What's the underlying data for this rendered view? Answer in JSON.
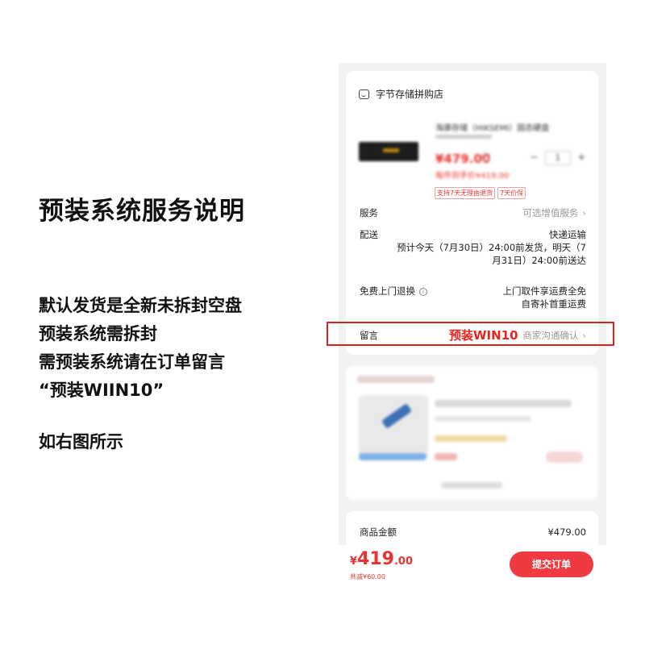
{
  "left": {
    "title": "预装系统服务说明",
    "notes": [
      "默认发货是全新未拆封空盘",
      "预装系统需拆封",
      "需预装系统请在订单留言",
      "“预装WIIN10”"
    ],
    "see_right": "如右图所示"
  },
  "order": {
    "shop_icon": "store-icon",
    "shop_name": "字节存储拼购店",
    "product": {
      "title": "海康存储（HIKSEMI）固态硬盘",
      "price": "¥479.00",
      "quantity": "1",
      "promo": "每件到手价¥419.00",
      "tags": [
        "支持7天无理由退货",
        "7天价保"
      ]
    },
    "service": {
      "label": "服务",
      "value": "可选增值服务"
    },
    "delivery": {
      "label": "配送",
      "method": "快递运输",
      "estimate_1": "预计今天（7月30日）24:00前发货，明天（7",
      "estimate_2": "月31日）24:00前送达"
    },
    "return": {
      "label": "免费上门退换",
      "value_1": "上门取件享运费全免",
      "value_2": "自寄补首重运费"
    },
    "message": {
      "label": "留言",
      "placeholder": "商家沟通确认"
    },
    "total": {
      "label": "商品金额",
      "value": "¥479.00"
    },
    "pay": {
      "yen": "¥",
      "int": "419",
      "dec": ".00",
      "saved": "共减¥60.00",
      "submit": "提交订单"
    }
  },
  "annotation": {
    "text": "预装WIN10",
    "color": "#d8231f"
  },
  "colors": {
    "accent": "#e8332e",
    "button": "#ee3a40"
  }
}
